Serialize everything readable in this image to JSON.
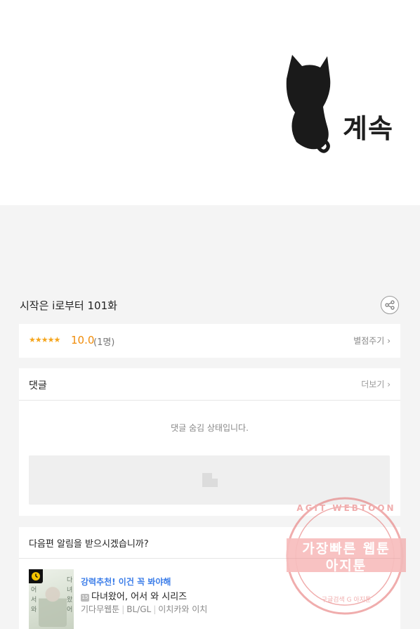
{
  "banner": {
    "continue_text": "계속"
  },
  "episode": {
    "title": "시작은 i로부터 101화"
  },
  "rating": {
    "stars": "★★★★★",
    "score": "10.0",
    "count": "(1명)",
    "rate_label": "별점주기",
    "star_color": "#f5a51c"
  },
  "comments": {
    "title": "댓글",
    "more_label": "더보기",
    "hidden_message": "댓글 숨김 상태입니다."
  },
  "notify": {
    "question": "다음편 알림을 받으시겠습니까?"
  },
  "recommendation": {
    "label": "강력추천! 이건 꼭 봐야해",
    "badge": "15",
    "title": "다녀왔어, 어서 와 시리즈",
    "meta": [
      "기다무웹툰",
      "BL/GL",
      "이치카와 이치"
    ],
    "cover_text": [
      "어",
      "서",
      "와",
      "다",
      "녀",
      "왔",
      "어"
    ],
    "label_color": "#3b7de9"
  },
  "watermark": {
    "top": "AGIT WEBTOON",
    "line1": "가장빠른 웹툰",
    "line2": "아지툰",
    "bottom": "구글검색  G  아지툰",
    "color": "#e46b6b"
  },
  "icons": [
    "share-icon",
    "chevron-right-icon",
    "clock-icon",
    "image-placeholder-icon",
    "cat-silhouette-icon"
  ]
}
